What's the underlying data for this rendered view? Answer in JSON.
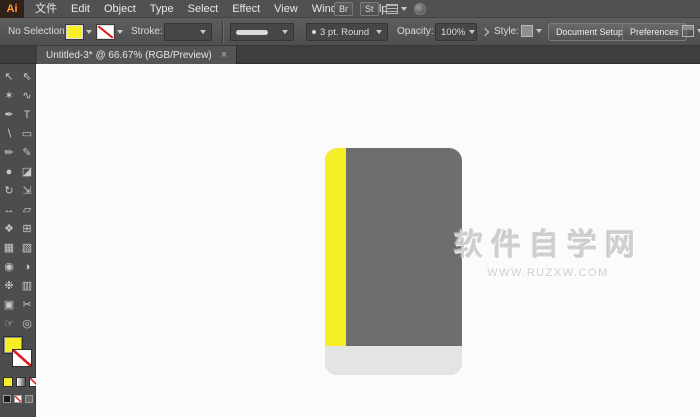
{
  "menubar": {
    "logo": "Ai",
    "items": [
      {
        "id": "file",
        "label": "文件"
      },
      {
        "id": "edit",
        "label": "Edit"
      },
      {
        "id": "object",
        "label": "Object"
      },
      {
        "id": "type",
        "label": "Type"
      },
      {
        "id": "select",
        "label": "Select"
      },
      {
        "id": "effect",
        "label": "Effect"
      },
      {
        "id": "view",
        "label": "View"
      },
      {
        "id": "window",
        "label": "Window"
      },
      {
        "id": "help",
        "label": "Help"
      }
    ],
    "br_button": "Br",
    "st_button": "St"
  },
  "controlbar": {
    "selection_status": "No Selection",
    "stroke_label": "Stroke:",
    "brush_value": "3 pt. Round",
    "opacity_label": "Opacity:",
    "opacity_value": "100%",
    "style_label": "Style:",
    "document_setup_button": "Document Setup",
    "preferences_button": "Preferences"
  },
  "tabbar": {
    "tab_title": "Untitled-3* @ 66.67% (RGB/Preview)",
    "close": "×"
  },
  "toolbar": {
    "tools": [
      {
        "name": "selection-tool",
        "glyph": "↖"
      },
      {
        "name": "direct-selection-tool",
        "glyph": "⇖"
      },
      {
        "name": "magic-wand-tool",
        "glyph": "✶"
      },
      {
        "name": "lasso-tool",
        "glyph": "∿"
      },
      {
        "name": "pen-tool",
        "glyph": "✒"
      },
      {
        "name": "type-tool",
        "glyph": "T"
      },
      {
        "name": "line-segment-tool",
        "glyph": "∖"
      },
      {
        "name": "rectangle-tool",
        "glyph": "▭"
      },
      {
        "name": "paintbrush-tool",
        "glyph": "✏"
      },
      {
        "name": "pencil-tool",
        "glyph": "✎"
      },
      {
        "name": "blob-brush-tool",
        "glyph": "●"
      },
      {
        "name": "eraser-tool",
        "glyph": "◪"
      },
      {
        "name": "rotate-tool",
        "glyph": "↻"
      },
      {
        "name": "scale-tool",
        "glyph": "⇲"
      },
      {
        "name": "width-tool",
        "glyph": "↔"
      },
      {
        "name": "free-transform-tool",
        "glyph": "▱"
      },
      {
        "name": "shape-builder-tool",
        "glyph": "❖"
      },
      {
        "name": "perspective-grid-tool",
        "glyph": "⊞"
      },
      {
        "name": "mesh-tool",
        "glyph": "▦"
      },
      {
        "name": "gradient-tool",
        "glyph": "▧"
      },
      {
        "name": "eyedropper-tool",
        "glyph": "◉"
      },
      {
        "name": "blend-tool",
        "glyph": "◑"
      },
      {
        "name": "symbol-sprayer-tool",
        "glyph": "❉"
      },
      {
        "name": "graph-tool",
        "glyph": "▥"
      },
      {
        "name": "artboard-tool",
        "glyph": "▣"
      },
      {
        "name": "slice-tool",
        "glyph": "✂"
      },
      {
        "name": "hand-tool",
        "glyph": "☞"
      },
      {
        "name": "zoom-tool",
        "glyph": "◎"
      }
    ]
  },
  "swatches": {
    "fill_color": "#f6ee27",
    "stroke": "none"
  },
  "artwork": {
    "book_body_color": "#6e6e6e",
    "book_spine_color": "#f6ee27",
    "book_bottom_color": "#e4e4e4"
  },
  "watermark": {
    "line1": "软件自学网",
    "line2": "WWW.RUZXW.COM"
  }
}
